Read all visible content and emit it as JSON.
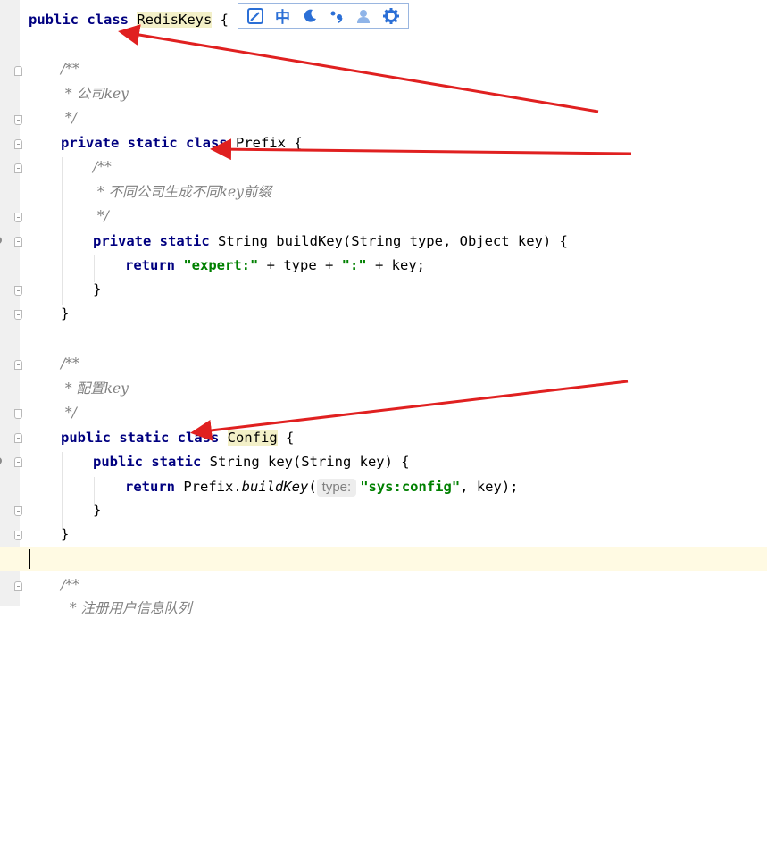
{
  "colors": {
    "keyword": "#000080",
    "comment": "#808080",
    "string": "#008000",
    "annotation_arrow": "#e02020",
    "current_line": "#fffae3",
    "ime_icon": "#2b6fd6"
  },
  "ime_toolbar": {
    "buttons": [
      {
        "name": "pen-edit-icon"
      },
      {
        "name": "chinese-mode",
        "label": "中"
      },
      {
        "name": "moon-icon"
      },
      {
        "name": "punctuation-icon"
      },
      {
        "name": "user-icon"
      },
      {
        "name": "gear-icon"
      }
    ]
  },
  "code": {
    "class_decl": {
      "kw": "public class",
      "name": "RedisKeys",
      "tail": " {"
    },
    "comment1": {
      "open": "/**",
      "body": " * 公司key",
      "close": " */"
    },
    "prefix_decl": {
      "kw": "private static class",
      "name": "Prefix",
      "tail": " {"
    },
    "comment2": {
      "open": "/**",
      "body": " * 不同公司生成不同key前缀",
      "close": " */"
    },
    "buildkey_sig": {
      "kw": "private static",
      "rest": " String buildKey(String type, Object key) {"
    },
    "buildkey_body": {
      "kw": "return",
      "s1": "\"expert:\"",
      "mid": " + type + ",
      "s2": "\":\"",
      "tail": " + key;"
    },
    "brace": "}",
    "comment3": {
      "open": "/**",
      "body": " * 配置key",
      "close": " */"
    },
    "config_decl": {
      "kw": "public static class",
      "name": "Config",
      "tail": " {"
    },
    "key_sig": {
      "kw": "public static",
      "rest": " String key(String key) {"
    },
    "key_body": {
      "kw": "return",
      "pre": " Prefix.",
      "fn": "buildKey",
      "paren": "(",
      "hint": "type:",
      "s": "\"sys:config\"",
      "tail": ", key);"
    },
    "comment4": {
      "open": "/**",
      "body": "  * 注册用户信息队列"
    }
  }
}
